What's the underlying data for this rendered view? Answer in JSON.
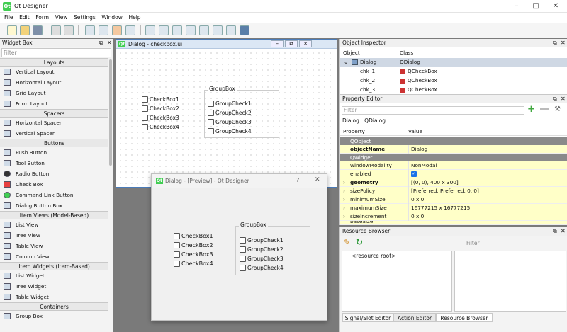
{
  "app": {
    "title": "Qt Designer",
    "logo": "Qt"
  },
  "menu": [
    "File",
    "Edit",
    "Form",
    "View",
    "Settings",
    "Window",
    "Help"
  ],
  "widget_box": {
    "title": "Widget Box",
    "filter_placeholder": "Filter",
    "categories": [
      {
        "name": "Layouts",
        "items": [
          "Vertical Layout",
          "Horizontal Layout",
          "Grid Layout",
          "Form Layout"
        ]
      },
      {
        "name": "Spacers",
        "items": [
          "Horizontal Spacer",
          "Vertical Spacer"
        ]
      },
      {
        "name": "Buttons",
        "items": [
          "Push Button",
          "Tool Button",
          "Radio Button",
          "Check Box",
          "Command Link Button",
          "Dialog Button Box"
        ]
      },
      {
        "name": "Item Views (Model-Based)",
        "items": [
          "List View",
          "Tree View",
          "Table View",
          "Column View"
        ]
      },
      {
        "name": "Item Widgets (Item-Based)",
        "items": [
          "List Widget",
          "Tree Widget",
          "Table Widget"
        ]
      },
      {
        "name": "Containers",
        "items": [
          "Group Box"
        ]
      }
    ]
  },
  "designer_form": {
    "title": "Dialog - checkbox.ui",
    "checkboxes": [
      "CheckBox1",
      "CheckBox2",
      "CheckBox3",
      "CheckBox4"
    ],
    "groupbox_title": "GroupBox",
    "group_checks": [
      "GroupCheck1",
      "GroupCheck2",
      "GroupCheck3",
      "GroupCheck4"
    ]
  },
  "preview": {
    "title": "Dialog - [Preview] - Qt Designer",
    "help_glyph": "?",
    "checkboxes": [
      "CheckBox1",
      "CheckBox2",
      "CheckBox3",
      "CheckBox4"
    ],
    "groupbox_title": "GroupBox",
    "group_checks": [
      "GroupCheck1",
      "GroupCheck2",
      "GroupCheck3",
      "GroupCheck4"
    ]
  },
  "object_inspector": {
    "title": "Object Inspector",
    "columns": [
      "Object",
      "Class"
    ],
    "rows": [
      {
        "object": "Dialog",
        "class": "QDialog"
      },
      {
        "object": "chk_1",
        "class": "QCheckBox"
      },
      {
        "object": "chk_2",
        "class": "QCheckBox"
      },
      {
        "object": "chk_3",
        "class": "QCheckBox"
      }
    ]
  },
  "property_editor": {
    "title": "Property Editor",
    "filter_placeholder": "Filter",
    "context": "Dialog : QDialog",
    "columns": [
      "Property",
      "Value"
    ],
    "groups": [
      {
        "name": "QObject",
        "props": [
          {
            "name": "objectName",
            "value": "Dialog"
          }
        ]
      },
      {
        "name": "QWidget",
        "props": [
          {
            "name": "windowModality",
            "value": "NonModal"
          },
          {
            "name": "enabled",
            "value": ""
          },
          {
            "name": "geometry",
            "value": "[(0, 0), 400 x 300]"
          },
          {
            "name": "sizePolicy",
            "value": "[Preferred, Preferred, 0, 0]"
          },
          {
            "name": "minimumSize",
            "value": "0 x 0"
          },
          {
            "name": "maximumSize",
            "value": "16777215 x 16777215"
          },
          {
            "name": "sizeIncrement",
            "value": "0 x 0"
          },
          {
            "name": "baseSize",
            "value": ""
          }
        ]
      }
    ]
  },
  "resource_browser": {
    "title": "Resource Browser",
    "filter_placeholder": "Filter",
    "root": "<resource root>"
  },
  "bottom_tabs": [
    "Signal/Slot Editor",
    "Action Editor",
    "Resource Browser"
  ],
  "colors": {
    "qt_green": "#41cd52",
    "property_row": "#ffffc8",
    "property_group": "#8a8a8a"
  }
}
